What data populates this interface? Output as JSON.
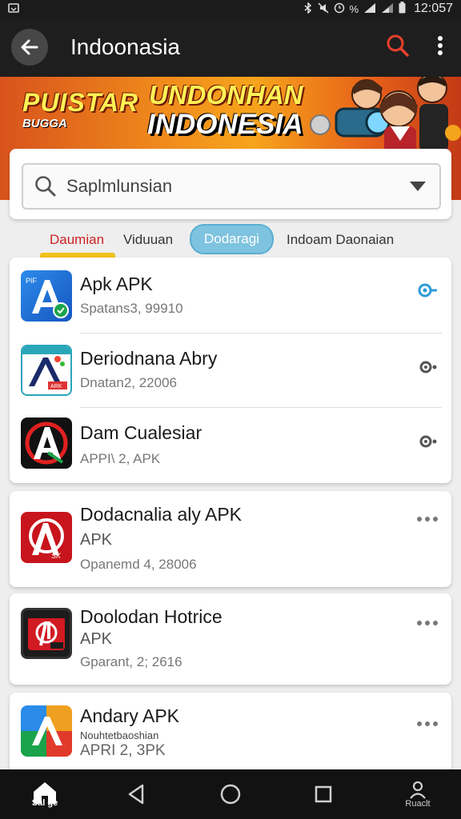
{
  "status_bar": {
    "time": "12:057",
    "percent": "%"
  },
  "app_bar": {
    "title": "Indoonasia"
  },
  "banner": {
    "line1": "PUISTAR",
    "line2": "BUGGA",
    "line3": "UNDONHAN",
    "line4": "INDONESIA"
  },
  "search": {
    "value": "Saplmlunsian"
  },
  "tabs": [
    {
      "label": "Daumian"
    },
    {
      "label": "Viduuan"
    },
    {
      "label": "Dodaragi"
    },
    {
      "label": "Indoam Daonaian"
    }
  ],
  "apps": [
    {
      "title": "Apk APK",
      "sub": "Spatans3, 99910",
      "icon": "apk-a-blue-icon",
      "action": "download-key-icon"
    },
    {
      "title": "Deriodnana Abry",
      "sub": "Dnatan2, 22006",
      "icon": "apk-a-teal-icon",
      "action": "download-key-icon"
    },
    {
      "title": "Dam Cualesiar",
      "sub": "APPI\\ 2, APK",
      "icon": "apk-a-black-icon",
      "action": "download-key-icon"
    }
  ],
  "cards": [
    {
      "title": "Dodacnalia aly APK",
      "type": "APK",
      "sub": "Opanemd 4, 28006",
      "icon": "apk-red-icon"
    },
    {
      "title": "Doolodan Hotrice",
      "type": "APK",
      "sub": "Gparant, 2; 2616",
      "icon": "apk-black-red-icon"
    },
    {
      "title": "Andary APK",
      "overlay": "Nouhtetbaoshian",
      "type": "APRI  2, 3PK",
      "icon": "apk-colorful-icon"
    }
  ],
  "bottom_nav": {
    "home_label": "Sal ge",
    "profile_label": "Ruaclt"
  },
  "colors": {
    "app_bar": "#1e1e1e",
    "search_icon_red": "#e8402c",
    "tab_active_red": "#cc2222",
    "tab_pill_blue": "#7ec3df",
    "tab_underline_yellow": "#f2c21c"
  }
}
